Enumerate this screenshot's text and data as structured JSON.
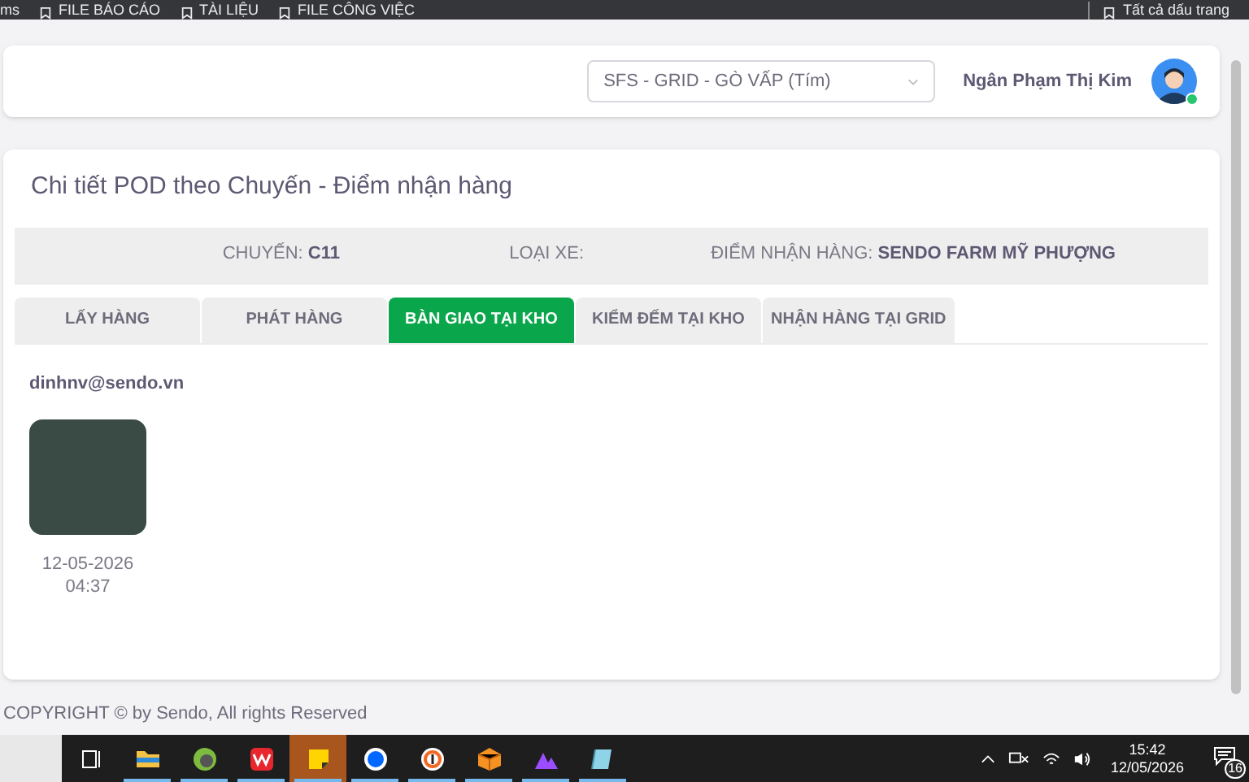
{
  "bookmarks_bar": {
    "items": [
      "ms",
      "FILE BÁO CÁO",
      "TÀI LIỆU",
      "FILE CÔNG VIỆC"
    ],
    "all_bookmarks": "Tất cả dấu trang"
  },
  "header": {
    "hub_select": {
      "value": "SFS - GRID - GÒ VẤP (Tím)"
    },
    "user_name": "Ngân Phạm Thị Kim",
    "online": true
  },
  "page": {
    "title": "Chi tiết POD theo Chuyến - Điểm nhận hàng",
    "info": [
      {
        "label": "CHUYẾN: ",
        "value": "C11"
      },
      {
        "label": "LOẠI XE:"
      },
      {
        "label": "ĐIỂM NHẬN HÀNG: ",
        "value": "SENDO FARM MỸ PHƯỢNG"
      }
    ],
    "tabs": [
      {
        "label": "LẤY HÀNG",
        "selected": false
      },
      {
        "label": "PHÁT HÀNG",
        "selected": false
      },
      {
        "label": "BÀN GIAO TẠI KHO",
        "selected": true
      },
      {
        "label": "KIỂM ĐẾM TẠI KHO",
        "selected": false
      },
      {
        "label": "NHẬN HÀNG TẠI GRID",
        "selected": false
      }
    ],
    "uploader": "dinhnv@sendo.vn",
    "photos": [
      {
        "date": "12-05-2026",
        "time": "04:37"
      }
    ]
  },
  "footer": "COPYRIGHT © by Sendo, All rights Reserved",
  "taskbar": {
    "apps": [
      {
        "kind": "taskview",
        "running": false,
        "selected": false
      },
      {
        "kind": "folder",
        "running": true,
        "selected": false
      },
      {
        "kind": "green",
        "running": true,
        "selected": false
      },
      {
        "kind": "wps",
        "running": true,
        "selected": false
      },
      {
        "kind": "notes",
        "running": true,
        "selected": true
      },
      {
        "kind": "zalo",
        "running": true,
        "selected": false
      },
      {
        "kind": "ring",
        "running": true,
        "selected": false
      },
      {
        "kind": "box",
        "running": true,
        "selected": false
      },
      {
        "kind": "purple",
        "running": true,
        "selected": false
      },
      {
        "kind": "book",
        "running": true,
        "selected": false
      }
    ],
    "time": "15:42",
    "date": "12/05/2026",
    "notifications": "16"
  }
}
